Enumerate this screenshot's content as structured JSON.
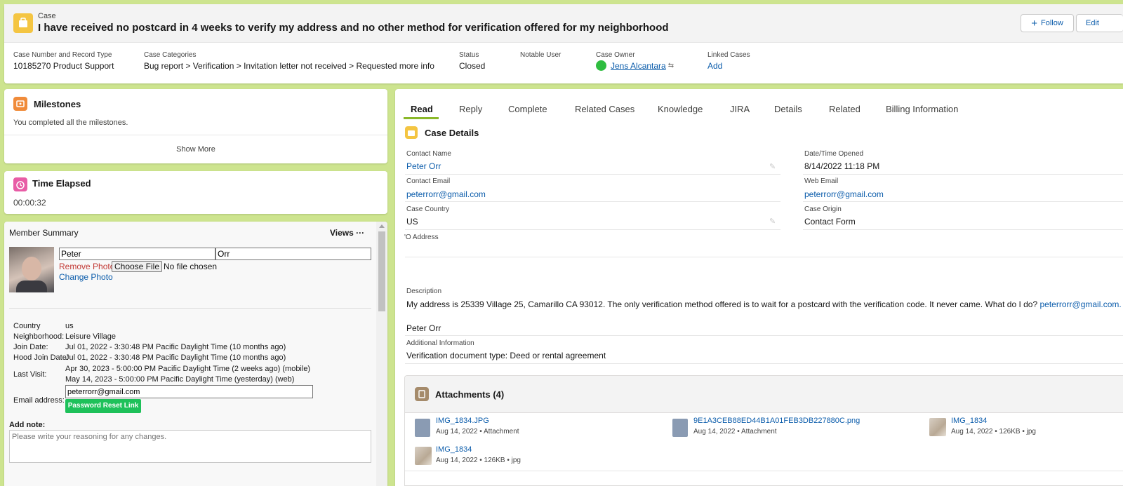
{
  "header": {
    "object_label": "Case",
    "title": "I have received no postcard in 4 weeks to verify my address and no other method for verification offered for my neighborhood",
    "follow_label": "Follow",
    "edit_label": "Edit",
    "fields": {
      "case_number_label": "Case Number and Record Type",
      "case_number_value": "10185270 Product Support",
      "categories_label": "Case Categories",
      "categories_value": "Bug report > Verification > Invitation letter not received > Requested more info",
      "status_label": "Status",
      "status_value": "Closed",
      "notable_user_label": "Notable User",
      "owner_label": "Case Owner",
      "owner_value": "Jens Alcantara",
      "linked_label": "Linked Cases",
      "linked_value": "Add"
    }
  },
  "milestones": {
    "title": "Milestones",
    "message": "You completed all the milestones.",
    "show_more": "Show More"
  },
  "time_elapsed": {
    "title": "Time Elapsed",
    "value": "00:00:32"
  },
  "member_summary": {
    "title": "Member Summary",
    "views_label": "Views",
    "first_name": "Peter",
    "last_name": "Orr",
    "remove_photo": "Remove Photo",
    "choose_file": "Choose File",
    "no_file": "No file chosen",
    "change_photo": "Change Photo",
    "rows": {
      "country_label": "Country",
      "country_value": "us",
      "neighborhood_label": "Neighborhood:",
      "neighborhood_value": "Leisure Village",
      "join_label": "Join Date:",
      "join_value": "Jul 01, 2022 - 3:30:48 PM Pacific Daylight Time (10 months ago)",
      "hood_join_label": "Hood Join Date:",
      "hood_join_value": "Jul 01, 2022 - 3:30:48 PM Pacific Daylight Time (10 months ago)",
      "last_visit_label": "Last Visit:",
      "last_visit_value_1": "Apr 30, 2023 - 5:00:00 PM Pacific Daylight Time (2 weeks ago) (mobile)",
      "last_visit_value_2": "May 14, 2023 - 5:00:00 PM Pacific Daylight Time (yesterday) (web)",
      "email_label": "Email address:",
      "email_value": "peterrorr@gmail.com",
      "password_reset": "Password Reset Link"
    },
    "add_note_label": "Add note:",
    "note_placeholder": "Please write your reasoning for any changes."
  },
  "tabs": [
    "Read",
    "Reply",
    "Complete",
    "Related Cases",
    "Knowledge",
    "JIRA",
    "Details",
    "Related",
    "Billing Information"
  ],
  "case_details": {
    "title": "Case Details",
    "contact_name_label": "Contact Name",
    "contact_name_value": "Peter Orr",
    "date_opened_label": "Date/Time Opened",
    "date_opened_value": "8/14/2022 11:18 PM",
    "contact_email_label": "Contact Email",
    "contact_email_value": "peterrorr@gmail.com",
    "web_email_label": "Web Email",
    "web_email_value": "peterrorr@gmail.com",
    "country_label": "Case Country",
    "country_value": "US",
    "origin_label": "Case Origin",
    "origin_value": "Contact Form",
    "po_address_label": "'O Address",
    "description_label": "Description",
    "description_text": "My address is 25339 Village 25, Camarillo CA 93012. The only verification method offered is to wait for a postcard with the verification code. It never came. What do I do?",
    "description_email": "peterrorr@gmail.com.",
    "description_signature": "Peter Orr",
    "additional_label": "Additional Information",
    "additional_value": "Verification document type: Deed or rental agreement"
  },
  "attachments": {
    "title": "Attachments (4)",
    "items": [
      {
        "name": "IMG_1834.JPG",
        "meta": "Aug 14, 2022 • Attachment"
      },
      {
        "name": "9E1A3CEB88ED44B1A01FEB3DB227880C.png",
        "meta": "Aug 14, 2022 • Attachment"
      },
      {
        "name": "IMG_1834",
        "meta": "Aug 14, 2022 • 126KB • jpg"
      },
      {
        "name": "IMG_1834",
        "meta": "Aug 14, 2022 • 126KB • jpg"
      }
    ]
  },
  "colors": {
    "page_bg": "#cde48f",
    "case_icon": "#f4c542",
    "milestone_icon": "#f08b3a",
    "time_icon": "#e85ca6",
    "owner_avatar": "#2fbd40",
    "reset_button": "#1ec15a",
    "link": "#0b5cab",
    "remove_photo": "#c23934",
    "active_tab": "#8ab829"
  }
}
